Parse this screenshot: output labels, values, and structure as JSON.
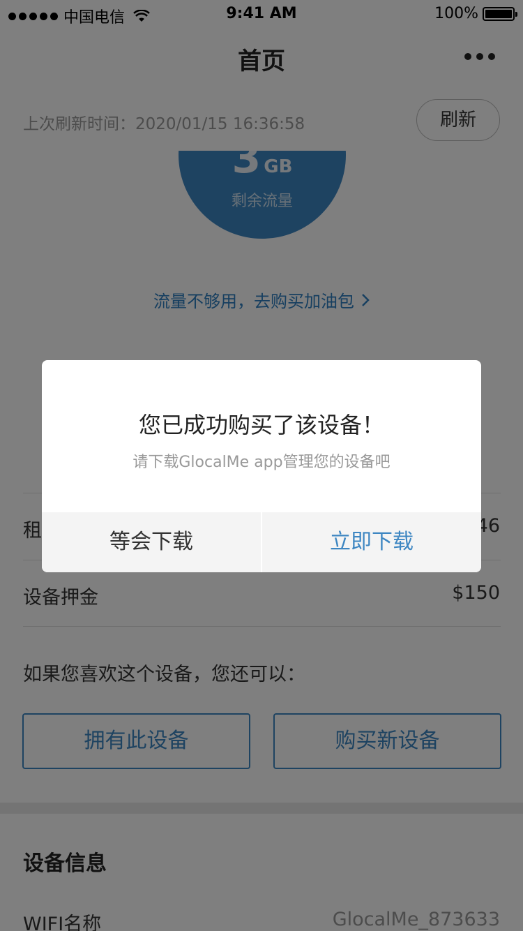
{
  "status_bar": {
    "carrier": "中国电信",
    "time": "9:41 AM",
    "battery": "100%"
  },
  "nav": {
    "title": "首页"
  },
  "refresh": {
    "last_refresh": "上次刷新时间：2020/01/15 16:36:58",
    "button_label": "刷新"
  },
  "data_circle": {
    "value": "3",
    "unit": "GB",
    "label": "剩余流量"
  },
  "buy_more_link": "流量不够用，去购买加油包",
  "rows": [
    {
      "label": "租",
      "value": "46"
    },
    {
      "label": "设备押金",
      "value": "$150"
    }
  ],
  "like_text": "如果您喜欢这个设备，您还可以：",
  "buttons": {
    "own_device": "拥有此设备",
    "buy_new": "购买新设备"
  },
  "device_info": {
    "title": "设备信息",
    "wifi_label": "WIFI名称",
    "wifi_value": "GlocalMe_873633"
  },
  "dialog": {
    "title": "您已成功购买了该设备！",
    "subtitle": "请下载GlocalMe app管理您的设备吧",
    "cancel_label": "等会下载",
    "confirm_label": "立即下载"
  },
  "colors": {
    "accent": "#3d86c2",
    "overlay": "rgba(0,0,0,0.5)"
  }
}
